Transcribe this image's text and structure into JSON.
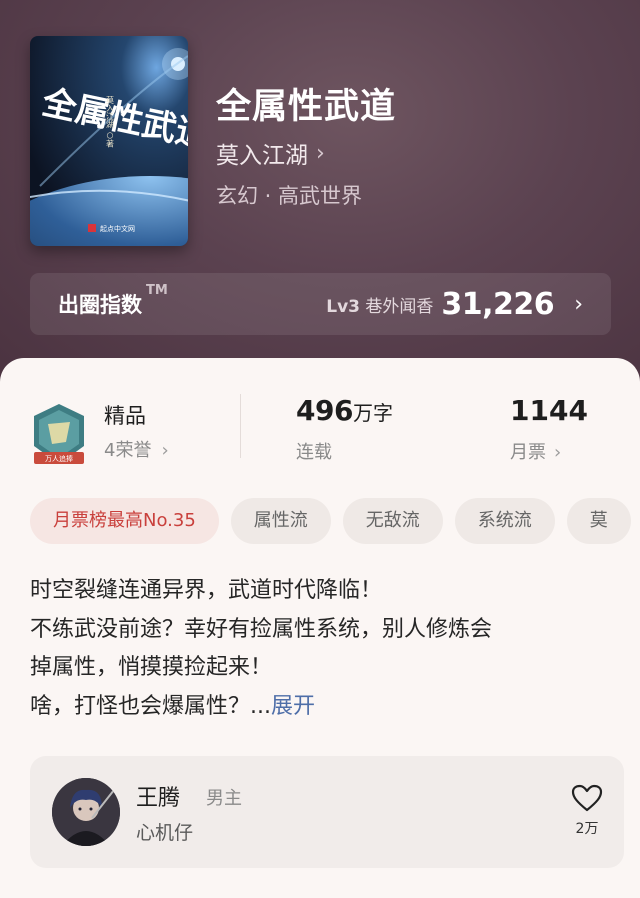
{
  "book": {
    "title": "全属性武道",
    "author": "莫入江湖",
    "genre": "玄幻 · 高武世界",
    "cover": {
      "title_text": "全属性武道",
      "author_text": "莫入江湖 ○著",
      "publisher_text": "起点中文网"
    }
  },
  "index": {
    "label": "出圈指数",
    "tm": "TM",
    "level": "Lv3",
    "level_desc": "巷外闻香",
    "value": "31,226"
  },
  "stats": {
    "quality": "精品",
    "honors": "4荣誉",
    "badge_text": "万人追捧",
    "word_count": "496",
    "word_unit": "万字",
    "status": "连载",
    "monthly_tickets": "1144",
    "monthly_label": "月票"
  },
  "tags": [
    "月票榜最高No.35",
    "属性流",
    "无敌流",
    "系统流",
    "莫"
  ],
  "synopsis": {
    "line1": "时空裂缝连通异界，武道时代降临！",
    "line2": "不练武没前途？幸好有捡属性系统，别人修炼会",
    "line3": "掉属性，悄摸摸捡起来！",
    "line4": "啥，打怪也会爆属性？...",
    "expand": "展开"
  },
  "character": {
    "name": "王腾",
    "role": "男主",
    "desc": "心机仔",
    "likes": "2万"
  },
  "colors": {
    "header_bg": "#5b4250",
    "card_bg": "#fbf6f4",
    "accent_red": "#c9403c",
    "link_blue": "#4e6ea8",
    "badge_green": "#3e7d83"
  }
}
